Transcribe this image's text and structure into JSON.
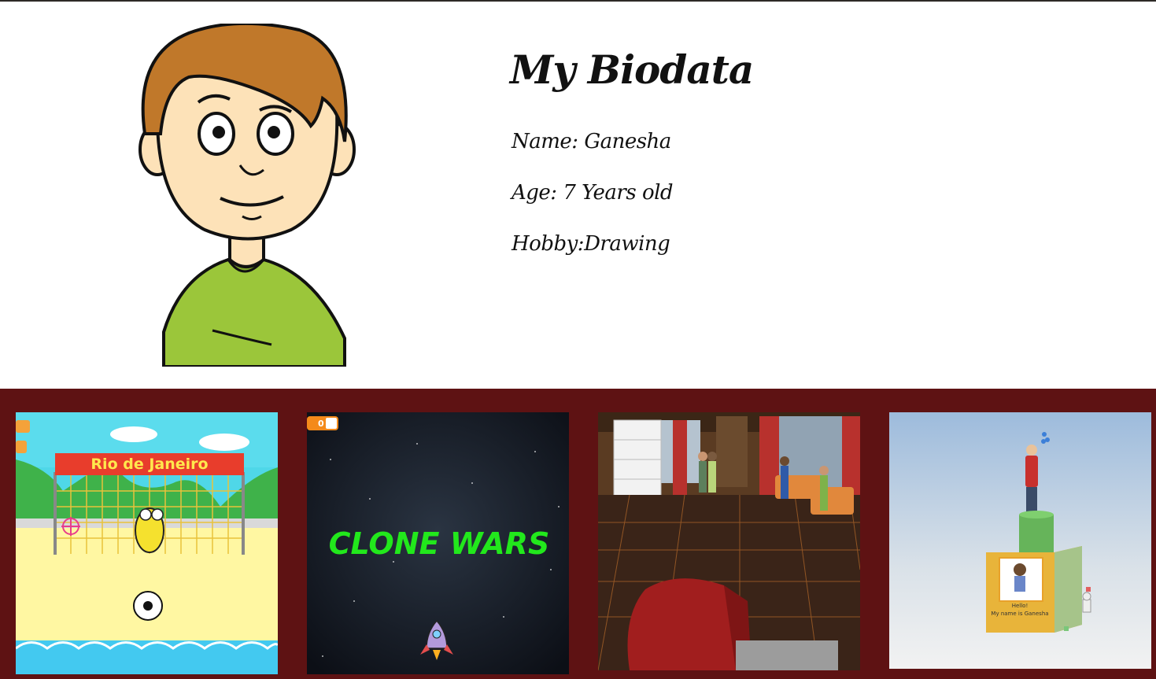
{
  "profile": {
    "title": "My Biodata",
    "name_line": "Name: Ganesha",
    "age_line": "Age: 7 Years old",
    "hobby_line": "Hobby:Drawing"
  },
  "projects": [
    {
      "banner": "Rio de Janeiro"
    },
    {
      "title": "CLONE WARS",
      "score": "0"
    },
    {
      "caption": ""
    },
    {
      "sign_line1": "Hello!",
      "sign_line2": "My name is Ganesha"
    }
  ],
  "colors": {
    "gallery_bg": "#5e1213",
    "shirt": "#9bc63a",
    "hair": "#c0782a"
  }
}
